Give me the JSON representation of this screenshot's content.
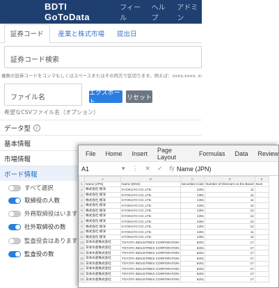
{
  "web": {
    "brand": "BDTI GoToData",
    "menu": [
      "フィール",
      "ヘルプ",
      "アドミン"
    ],
    "tabs": [
      "証券コード",
      "産業と株式市場",
      "提出日"
    ],
    "stock_input_placeholder": "証券コード検索",
    "stock_hint": "複数の証券コードをコンマもしくはスペースまたはその両方で区切ります。例えば：xxxx,xxxx, xxxx xxxx",
    "file_input_placeholder": "ファイル名",
    "export_button": "エクスポート",
    "reset_button": "リセット",
    "file_hint": "希望なCSVファイル名（オプション）",
    "data_type_label": "データ型",
    "info_icon_glyph": "i",
    "sections": [
      "基本情報",
      "市場情報",
      "ボード情報"
    ],
    "toggles": [
      {
        "label": "すべて選択",
        "on": false
      },
      {
        "label": "取締役の人数",
        "on": true
      },
      {
        "label": "外務取締役はいますか？",
        "on": false
      },
      {
        "label": "社外取締役の数",
        "on": true
      },
      {
        "label": "監査役会はありますか？",
        "on": false
      },
      {
        "label": "監査役の数",
        "on": true
      }
    ],
    "accent": "#2a7de1",
    "header_bg": "#1f3f70"
  },
  "excel": {
    "menu": [
      "File",
      "Home",
      "Insert",
      "Page Layout",
      "Formulas",
      "Data",
      "Review"
    ],
    "name_box": "A1",
    "fx_icons": [
      "▾",
      "⋮",
      "✕",
      "✓",
      "fx"
    ],
    "formula_value": "Name (JPN)",
    "col_letters": [
      "A",
      "B",
      "C",
      "D",
      "E"
    ],
    "headers": [
      "Name (JPN)",
      "Name (ENG)",
      "Securities Code",
      "Number of Directors on the Board",
      "Num"
    ],
    "rows": [
      [
        "株式会社 極洋",
        "KYOKUYO CO.,LTD.",
        "1301",
        "11"
      ],
      [
        "株式会社 極洋",
        "KYOKUYO CO.,LTD.",
        "1301",
        "11"
      ],
      [
        "株式会社 極洋",
        "KYOKUYO CO.,LTD.",
        "1301",
        "11"
      ],
      [
        "株式会社 極洋",
        "KYOKUYO CO.,LTD.",
        "1301",
        "12"
      ],
      [
        "株式会社 極洋",
        "KYOKUYO CO.,LTD.",
        "1301",
        "12"
      ],
      [
        "株式会社 極洋",
        "KYOKUYO CO.,LTD.",
        "1301",
        "12"
      ],
      [
        "株式会社 極洋",
        "KYOKUYO CO.,LTD.",
        "1301",
        "12"
      ],
      [
        "株式会社 極洋",
        "KYOKUYO CO.,LTD.",
        "1301",
        "12"
      ],
      [
        "株式会社 極洋",
        "KYOKUYO CO.,LTD.",
        "1301",
        "11"
      ],
      [
        "株式会社 極洋",
        "KYOKUYO CO.,LTD.",
        "1301",
        "11"
      ],
      [
        "日本水産株式会社",
        "TOYOTA INDUSTRIES CORPORATION",
        "6201",
        "17"
      ],
      [
        "日本水産株式会社",
        "TOYOTA INDUSTRIES CORPORATION",
        "6201",
        "17"
      ],
      [
        "日本水産株式会社",
        "TOYOTA INDUSTRIES CORPORATION",
        "6201",
        "17"
      ],
      [
        "日本水産株式会社",
        "TOYOTA INDUSTRIES CORPORATION",
        "6201",
        "17"
      ],
      [
        "日本水産株式会社",
        "TOYOTA INDUSTRIES CORPORATION",
        "6201",
        "17"
      ],
      [
        "日本水産株式会社",
        "TOYOTA INDUSTRIES CORPORATION",
        "6201",
        "17"
      ],
      [
        "日本水産株式会社",
        "TOYOTA INDUSTRIES CORPORATION",
        "6201",
        "17"
      ],
      [
        "日本水産株式会社",
        "TOYOTA INDUSTRIES CORPORATION",
        "6201",
        "17"
      ]
    ]
  }
}
